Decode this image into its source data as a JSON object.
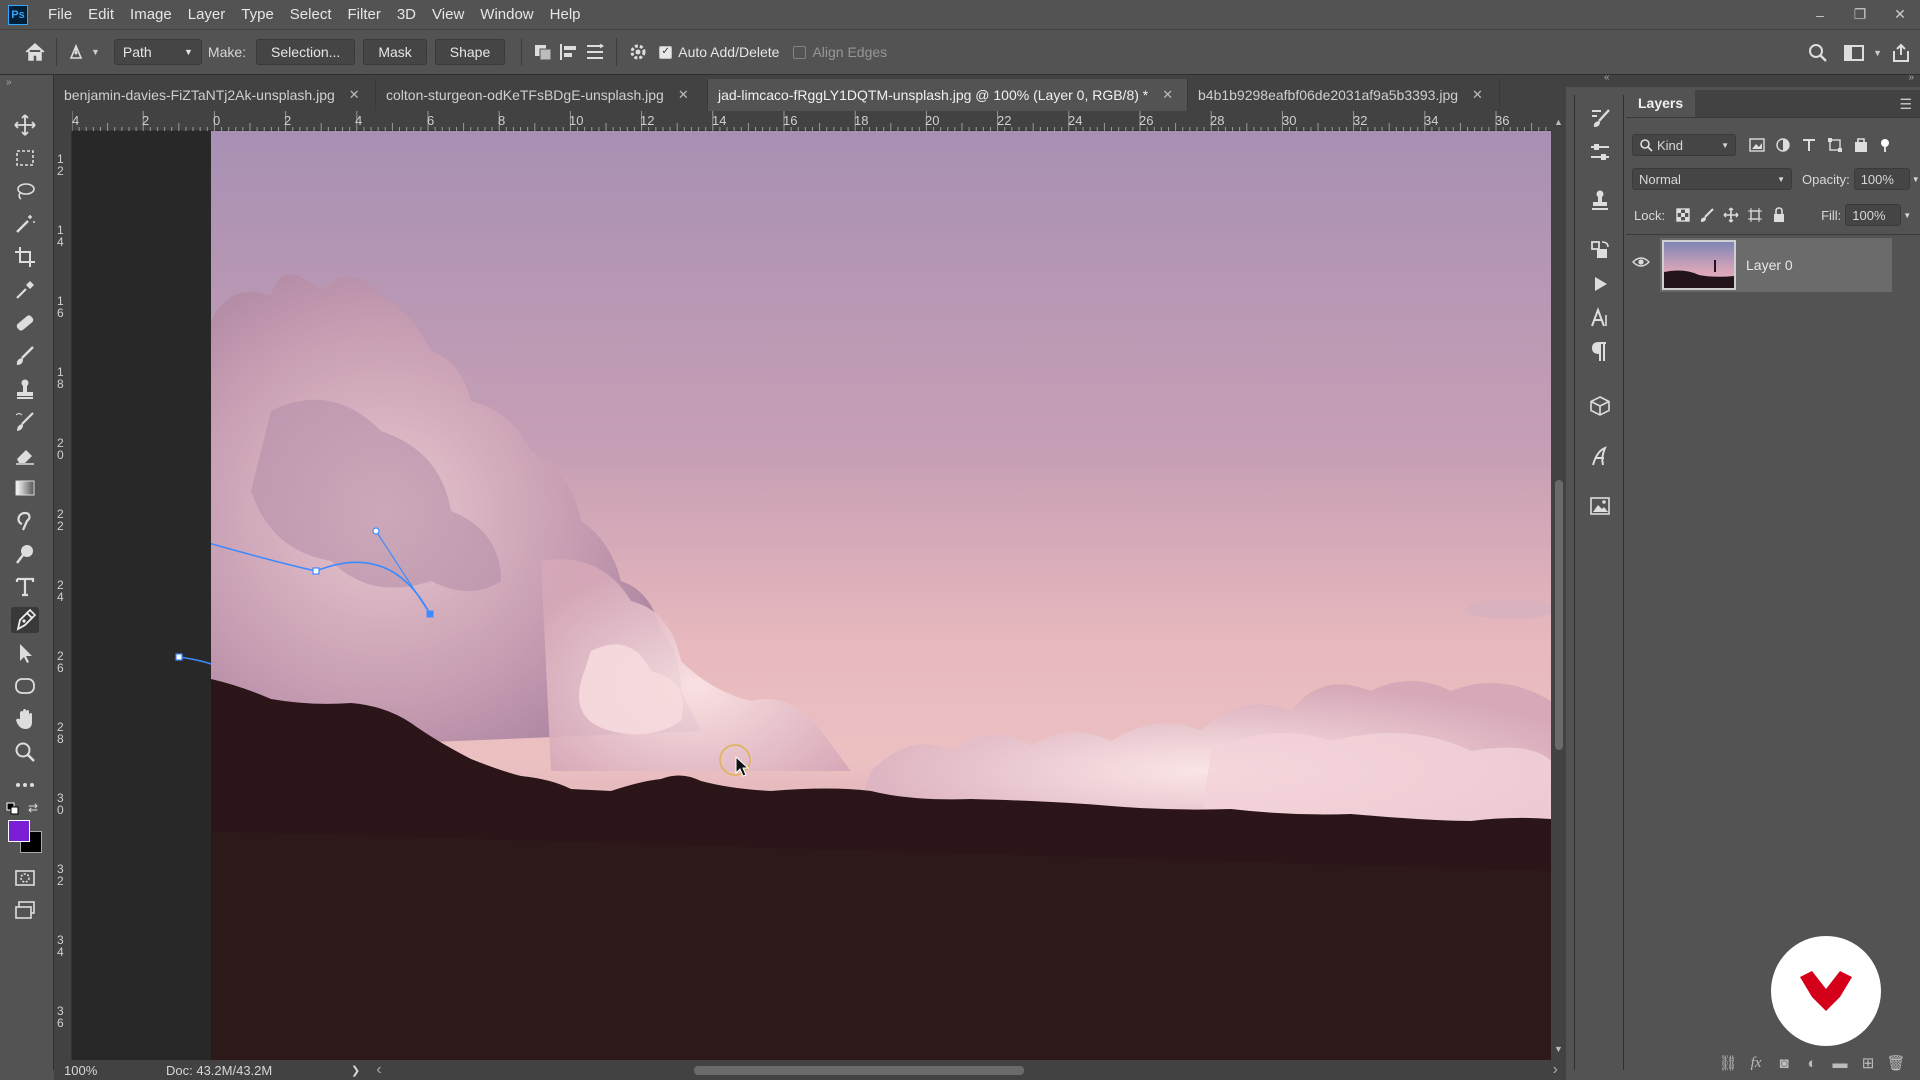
{
  "app": {
    "logo_text": "Ps"
  },
  "menu": [
    "File",
    "Edit",
    "Image",
    "Layer",
    "Type",
    "Select",
    "Filter",
    "3D",
    "View",
    "Window",
    "Help"
  ],
  "window_controls": {
    "minimize": "–",
    "restore": "❐",
    "close": "✕"
  },
  "options_bar": {
    "mode_select": "Path",
    "make_label": "Make:",
    "selection_button": "Selection...",
    "mask_button": "Mask",
    "shape_button": "Shape",
    "auto_add_delete": {
      "label": "Auto Add/Delete",
      "checked": true
    },
    "align_edges": {
      "label": "Align Edges",
      "checked": false
    }
  },
  "tabs": [
    {
      "label": "benjamin-davies-FiZTaNTj2Ak-unsplash.jpg",
      "active": false
    },
    {
      "label": "colton-sturgeon-odKeTFsBDgE-unsplash.jpg",
      "active": false
    },
    {
      "label": "jad-limcaco-fRggLY1DQTM-unsplash.jpg @ 100% (Layer 0, RGB/8) *",
      "active": true
    },
    {
      "label": "b4b1b9298eafbf06de2031af9a5b3393.jpg",
      "active": false
    }
  ],
  "tab_close": "✕",
  "ruler": {
    "top_labels": [
      "4",
      "2",
      "0",
      "2",
      "4",
      "6",
      "8",
      "10",
      "12",
      "14",
      "16",
      "18",
      "20",
      "22",
      "24",
      "26",
      "28",
      "30",
      "32",
      "34",
      "36"
    ],
    "left_labels": [
      "1\n2",
      "1\n4",
      "1\n6",
      "1\n8",
      "2\n0",
      "2\n2",
      "2\n4",
      "2\n6",
      "2\n8",
      "3\n0",
      "3\n2",
      "3\n4",
      "3\n6"
    ]
  },
  "status_bar": {
    "zoom": "100%",
    "doc": "Doc: 43.2M/43.2M",
    "arrow": "❯",
    "left_arrow": "‹",
    "right_arrow": "›"
  },
  "colors": {
    "foreground": "#7a1fd6",
    "background": "#000000",
    "path": "#3d8bff",
    "brand": "#d4001a"
  },
  "layers_panel": {
    "tab_label": "Layers",
    "filter_kind": "Kind",
    "blend_mode": "Normal",
    "opacity_label": "Opacity:",
    "opacity_value": "100%",
    "lock_label": "Lock:",
    "fill_label": "Fill:",
    "fill_value": "100%",
    "layers": [
      {
        "name": "Layer 0",
        "visible": true
      }
    ]
  }
}
